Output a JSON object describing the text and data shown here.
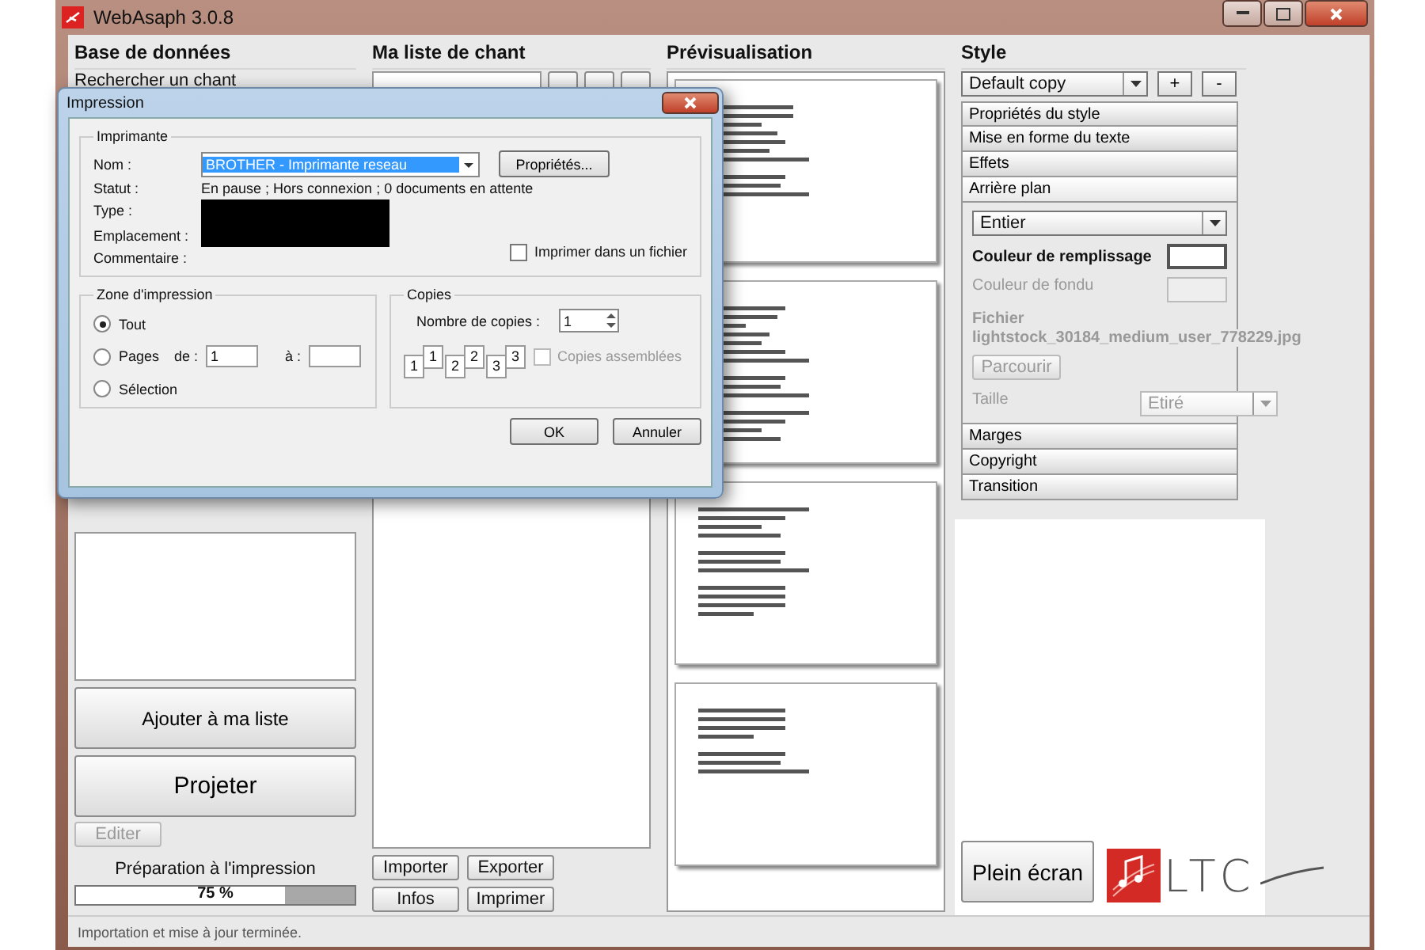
{
  "window": {
    "title": "WebAsaph 3.0.8"
  },
  "database": {
    "heading": "Base de données",
    "search_label": "Rechercher un chant",
    "add_button": "Ajouter à ma liste",
    "project_button": "Projeter",
    "edit_button": {
      "label": "Editer",
      "disabled": true
    },
    "progress_label": "Préparation à l'impression",
    "progress": {
      "level": 0.75,
      "reading": "75 %"
    }
  },
  "songlist": {
    "heading": "Ma liste de chant",
    "buttons": [
      "Importer",
      "Exporter",
      "Infos",
      "Imprimer"
    ]
  },
  "preview": {
    "heading": "Prévisualisation"
  },
  "style": {
    "heading": "Style",
    "preset": "Default copy",
    "add": "+",
    "remove": "-",
    "sections": [
      {
        "label": "Propriétés du style",
        "expanded": false
      },
      {
        "label": "Mise en forme du texte",
        "expanded": false
      },
      {
        "label": "Effets",
        "expanded": false
      },
      {
        "label": "Arrière plan",
        "expanded": true
      },
      {
        "label": "Marges",
        "expanded": false
      },
      {
        "label": "Copyright",
        "expanded": false
      },
      {
        "label": "Transition",
        "expanded": false
      }
    ],
    "background": {
      "mode": "Entier",
      "fill_label": "Couleur de remplissage",
      "fade_label": "Couleur de fondu",
      "fade_disabled": true,
      "file_label": "Fichier",
      "file_name": "lightstock_30184_medium_user_778229.jpg",
      "browse": {
        "label": "Parcourir",
        "disabled": true
      },
      "size_label": "Taille",
      "size_value": "Etiré",
      "size_disabled": true
    }
  },
  "fullscreen_button": "Plein écran",
  "logo_text": "LTC",
  "status_bar": "Importation et mise à jour terminée.",
  "dialog": {
    "title": "Impression",
    "printer": {
      "legend": "Imprimante",
      "name_label": "Nom :",
      "name_value": "BROTHER - Imprimante reseau",
      "properties": "Propriétés...",
      "status_label": "Statut :",
      "status_value": "En pause ; Hors connexion ; 0 documents en attente",
      "type_label": "Type :",
      "location_label": "Emplacement :",
      "comment_label": "Commentaire :",
      "print_to_file": {
        "label": "Imprimer dans un fichier",
        "checked": false
      }
    },
    "range": {
      "legend": "Zone d'impression",
      "options": [
        {
          "label": "Tout",
          "selected": true
        },
        {
          "label": "Pages",
          "selected": false
        },
        {
          "label": "Sélection",
          "selected": false
        }
      ],
      "from_label": "de :",
      "from_value": "1",
      "to_label": "à :"
    },
    "copies": {
      "legend": "Copies",
      "count_label": "Nombre de copies :",
      "count": "1",
      "collate_pages": [
        {
          "front": "1",
          "back": "1"
        },
        {
          "front": "2",
          "back": "2"
        },
        {
          "front": "3",
          "back": "3"
        }
      ],
      "collate": {
        "label": "Copies assemblées",
        "checked": false,
        "disabled": true
      }
    },
    "ok": "OK",
    "cancel": "Annuler"
  }
}
